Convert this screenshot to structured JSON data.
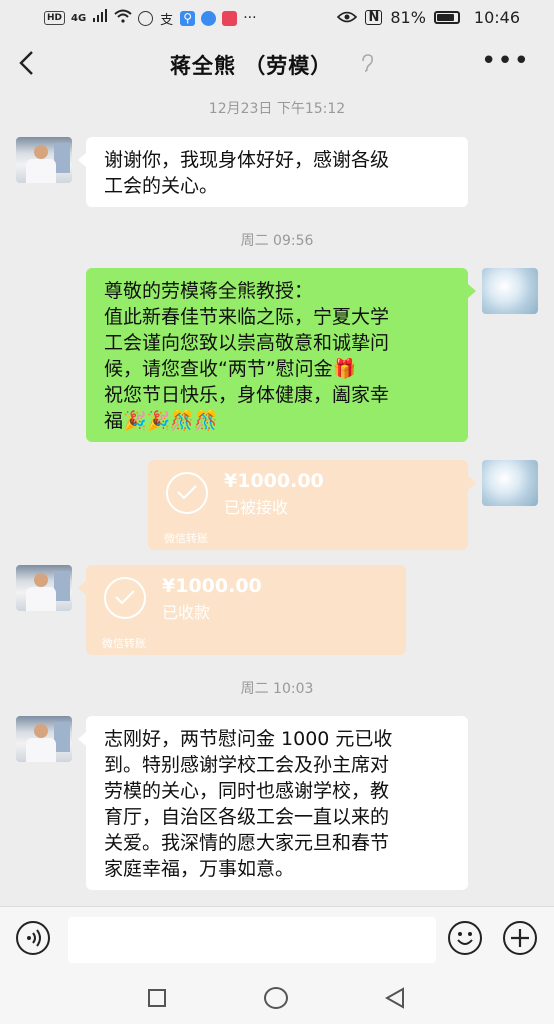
{
  "status_bar": {
    "network_badge": "HD",
    "network_type": "4G",
    "battery_percent": "81%",
    "time": "10:46"
  },
  "header": {
    "title": "蒋全熊 （劳模）",
    "back_icon": "chevron-left-icon",
    "more_icon": "more-dots-icon",
    "mute_icon": "ear-icon"
  },
  "messages": [
    {
      "type": "timestamp",
      "text": "12月23日 下午15:12"
    },
    {
      "type": "text",
      "side": "left",
      "text": "谢谢你，我现身体好好，感谢各级\n工会的关心。"
    },
    {
      "type": "timestamp",
      "text": "周二 09:56"
    },
    {
      "type": "text",
      "side": "right",
      "text": "尊敬的劳模蒋全熊教授：\n值此新春佳节来临之际，宁夏大学\n工会谨向您致以崇高敬意和诚挚问\n候，请您查收“两节”慰问金🎁\n祝您节日快乐，身体健康，阖家幸\n福🎉🎉🎊🎊"
    },
    {
      "type": "transfer",
      "side": "right",
      "amount": "¥1000.00",
      "status": "已被接收",
      "footer": "微信转账"
    },
    {
      "type": "transfer",
      "side": "left",
      "amount": "¥1000.00",
      "status": "已收款",
      "footer": "微信转账"
    },
    {
      "type": "timestamp",
      "text": "周二 10:03"
    },
    {
      "type": "text",
      "side": "left",
      "text": "志刚好，两节慰问金 1000 元已收\n到。特别感谢学校工会及孙主席对\n劳模的关心，同时也感谢学校，教\n育厅，自治区各级工会一直以来的\n关爱。我深情的愿大家元旦和春节\n家庭幸福，万事如意。"
    }
  ],
  "input_bar": {
    "voice_icon": "voice-icon",
    "input_value": "",
    "emoji_icon": "emoji-icon",
    "plus_icon": "plus-icon"
  },
  "nav_bar": {
    "recent_icon": "square-icon",
    "home_icon": "circle-icon",
    "back_icon": "triangle-back-icon"
  },
  "colors": {
    "background": "#ededed",
    "self_bubble": "#95ec69",
    "other_bubble": "#ffffff",
    "transfer_bubble": "#fbe2c8",
    "timestamp": "#999999"
  }
}
